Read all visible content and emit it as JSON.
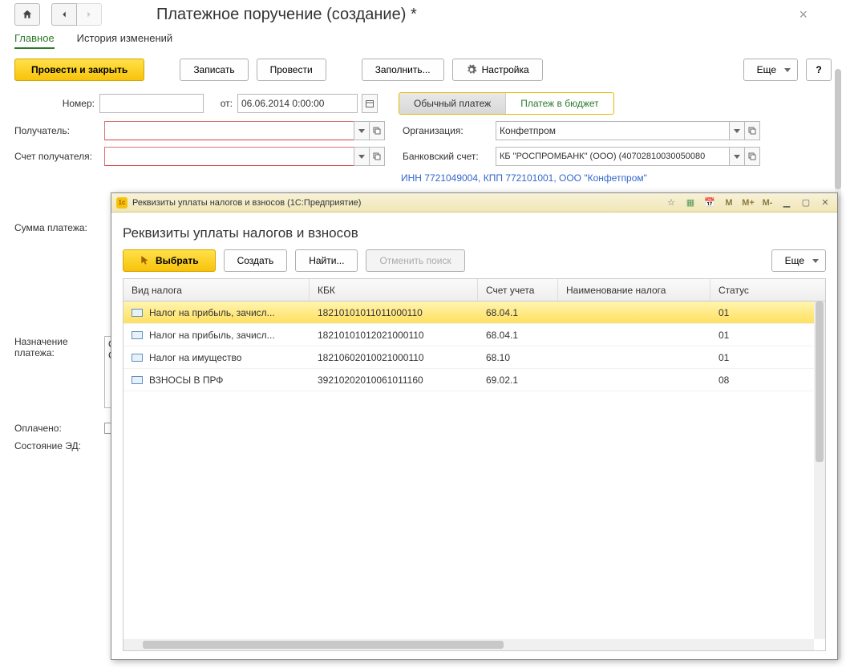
{
  "page": {
    "title": "Платежное поручение (создание) *"
  },
  "tabs": {
    "main": "Главное",
    "history": "История изменений"
  },
  "toolbar": {
    "post_close": "Провести и закрыть",
    "save": "Записать",
    "post": "Провести",
    "fill": "Заполнить...",
    "settings": "Настройка",
    "more": "Еще",
    "help": "?"
  },
  "form": {
    "number_lbl": "Номер:",
    "from_lbl": "от:",
    "date_val": "06.06.2014  0:00:00",
    "seg_regular": "Обычный платеж",
    "seg_budget": "Платеж в бюджет",
    "recipient_lbl": "Получатель:",
    "rec_account_lbl": "Счет получателя:",
    "org_lbl": "Организация:",
    "org_val": "Конфетпром",
    "bank_acc_lbl": "Банковский счет:",
    "bank_acc_val": "КБ \"РОСПРОМБАНК\" (ООО) (40702810030050080",
    "inn_text": "ИНН 7721049004, КПП 772101001, ООО \"Конфетпром\"",
    "sum_lbl": "Сумма платежа:",
    "purpose_lbl_1": "Назначение",
    "purpose_lbl_2": "платежа:",
    "purpose_prefix_1": "О",
    "purpose_prefix_2": "С",
    "paid_lbl": "Оплачено:",
    "ed_state_lbl": "Состояние ЭД:"
  },
  "modal": {
    "title": "Реквизиты уплаты налогов и взносов  (1С:Предприятие)",
    "heading": "Реквизиты уплаты налогов и взносов",
    "select": "Выбрать",
    "create": "Создать",
    "find": "Найти...",
    "cancel_search": "Отменить поиск",
    "more": "Еще",
    "m": "M",
    "mplus": "M+",
    "mminus": "M-",
    "cols": {
      "c1": "Вид налога",
      "c2": "КБК",
      "c3": "Счет учета",
      "c4": "Наименование налога",
      "c5": "Статус"
    },
    "rows": [
      {
        "c1": "Налог на прибыль, зачисл...",
        "c2": "18210101011011000110",
        "c3": "68.04.1",
        "c4": "",
        "c5": "01"
      },
      {
        "c1": "Налог на прибыль, зачисл...",
        "c2": "18210101012021000110",
        "c3": "68.04.1",
        "c4": "",
        "c5": "01"
      },
      {
        "c1": "Налог на имущество",
        "c2": "18210602010021000110",
        "c3": "68.10",
        "c4": "",
        "c5": "01"
      },
      {
        "c1": "ВЗНОСЫ В ПРФ",
        "c2": "39210202010061011160",
        "c3": "69.02.1",
        "c4": "",
        "c5": "08"
      }
    ]
  }
}
